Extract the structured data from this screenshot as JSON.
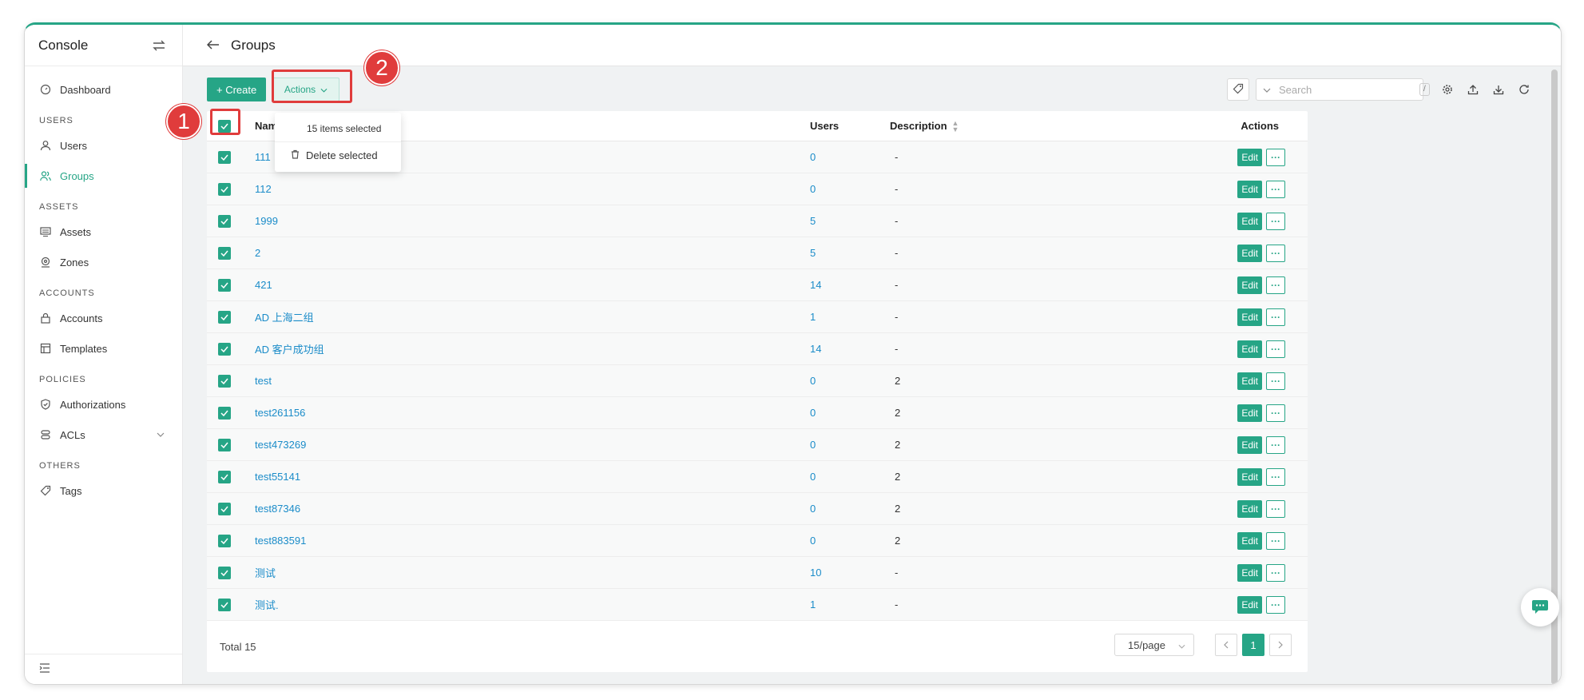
{
  "sidebar": {
    "title": "Console",
    "items": {
      "dashboard": "Dashboard",
      "users": "Users",
      "groups": "Groups",
      "assets": "Assets",
      "zones": "Zones",
      "accounts": "Accounts",
      "templates": "Templates",
      "authorizations": "Authorizations",
      "acls": "ACLs",
      "tags": "Tags"
    },
    "sections": {
      "users": "USERS",
      "assets": "ASSETS",
      "accounts": "ACCOUNTS",
      "policies": "POLICIES",
      "others": "OTHERS"
    }
  },
  "header": {
    "title": "Groups"
  },
  "toolbar": {
    "create_label": "+ Create",
    "actions_label": "Actions",
    "search_placeholder": "Search",
    "search_shortcut": "/"
  },
  "dropdown": {
    "selected_label": "15 items selected",
    "delete_label": "Delete selected"
  },
  "table": {
    "columns": {
      "name": "Name",
      "users": "Users",
      "description": "Description",
      "actions": "Actions"
    },
    "edit_label": "Edit",
    "more_label": "···",
    "rows": [
      {
        "name": "111",
        "users": "0",
        "description": "-"
      },
      {
        "name": "112",
        "users": "0",
        "description": "-"
      },
      {
        "name": "1999",
        "users": "5",
        "description": "-"
      },
      {
        "name": "2",
        "users": "5",
        "description": "-"
      },
      {
        "name": "421",
        "users": "14",
        "description": "-"
      },
      {
        "name": "AD 上海二组",
        "users": "1",
        "description": "-"
      },
      {
        "name": "AD 客户成功组",
        "users": "14",
        "description": "-"
      },
      {
        "name": "test",
        "users": "0",
        "description": "2"
      },
      {
        "name": "test261156",
        "users": "0",
        "description": "2"
      },
      {
        "name": "test473269",
        "users": "0",
        "description": "2"
      },
      {
        "name": "test55141",
        "users": "0",
        "description": "2"
      },
      {
        "name": "test87346",
        "users": "0",
        "description": "2"
      },
      {
        "name": "test883591",
        "users": "0",
        "description": "2"
      },
      {
        "name": "测试",
        "users": "10",
        "description": "-"
      },
      {
        "name": "测试.",
        "users": "1",
        "description": "-"
      }
    ]
  },
  "footer": {
    "total_label": "Total 15",
    "page_size": "15/page",
    "current_page": "1"
  },
  "annotations": {
    "badge1": "1",
    "badge2": "2"
  },
  "colors": {
    "accent": "#26a586",
    "link": "#1b8cc9",
    "highlight": "#e03c3c"
  }
}
